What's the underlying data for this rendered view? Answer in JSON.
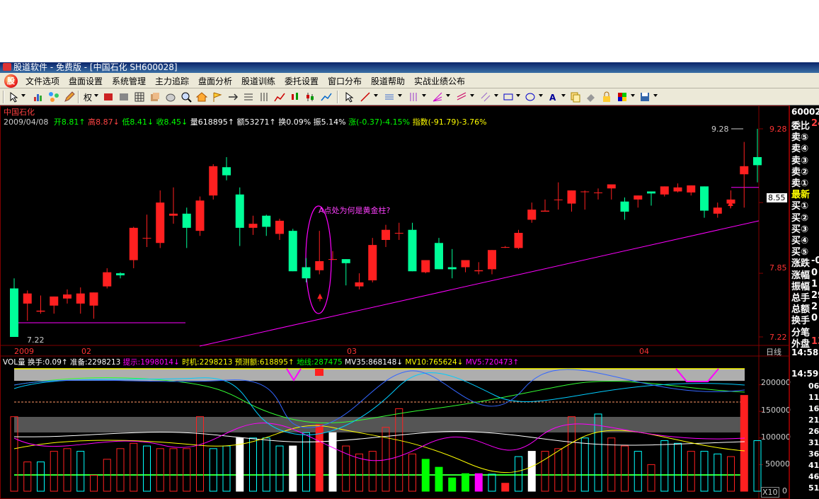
{
  "window": {
    "title": "股道软件 - 免费版 - [中国石化 SH600028]"
  },
  "menu": [
    "文件选项",
    "盘面设置",
    "系统管理",
    "主力追踪",
    "盘面分析",
    "股道训练",
    "委托设置",
    "窗口分布",
    "股道帮助",
    "实战业绩公布"
  ],
  "toolbar": {
    "rights_label": "权"
  },
  "header": {
    "stock_name": "中国石化",
    "date": "2009/04/08",
    "open": "开8.81↑",
    "high": "高8.87↓",
    "low": "低8.41↓",
    "close": "收8.45↓",
    "volume": "量618895↑",
    "amount": "额53271↑",
    "turnover": "换0.09%",
    "amplitude": "振5.14%",
    "change": "涨(-0.37)-4.15%",
    "index": "指数(-91.79)-3.76%"
  },
  "annotation": {
    "question": "A点处为何是黄金柱?",
    "high_label": "9.28",
    "low_label": "7.22"
  },
  "price_axis": {
    "ticks": [
      "9.28",
      "8.55",
      "7.85",
      "7.22"
    ]
  },
  "date_axis": {
    "labels": [
      "2009",
      "02",
      "03",
      "04"
    ],
    "period": "日线"
  },
  "vol_header": {
    "label": "VOL量",
    "turnover": "换手:0.09↑",
    "prepare": "准备:2298213",
    "hint": "提示:1998014↓",
    "timing": "时机:2298213",
    "forecast": "预测额:618895↑",
    "ground": "地线:287475",
    "mv35": "MV35:868148↓",
    "mv10": "MV10:765624↓",
    "mv5": "MV5:720473↑"
  },
  "vol_axis": {
    "ticks": [
      "200000",
      "150000",
      "100000",
      "50000",
      "0"
    ],
    "unit": "X10"
  },
  "side_panel": {
    "code": "60002",
    "rows": [
      "委比",
      "卖⑤",
      "卖④",
      "卖③",
      "卖②",
      "卖①",
      "最新",
      "买①",
      "买②",
      "买③",
      "买④",
      "买⑤",
      "涨跌",
      "涨幅",
      "振幅",
      "总手",
      "总额",
      "换手",
      "分笔",
      "外盘"
    ],
    "values": [
      "24",
      "",
      "",
      "",
      "",
      "",
      "",
      "",
      "",
      "",
      "",
      "",
      "-0",
      "0",
      "1",
      "29",
      "2",
      "0",
      "",
      "13"
    ],
    "times": [
      "14:58",
      "14:59"
    ],
    "tick_vals": [
      "06",
      "11",
      "16",
      "21",
      "26",
      "31",
      "36",
      "41",
      "46",
      "51"
    ]
  },
  "colors": {
    "up": "#ff2020",
    "down": "#00ff99",
    "bg": "#000000",
    "grid": "#800000",
    "magenta": "#ff00ff",
    "yellow": "#ffff00",
    "cyan": "#00ffff"
  },
  "chart_data": {
    "type": "candlestick",
    "candles": [
      {
        "o": 7.7,
        "h": 7.8,
        "l": 7.22,
        "c": 7.22
      },
      {
        "o": 7.55,
        "h": 7.68,
        "l": 7.38,
        "c": 7.65
      },
      {
        "o": 7.47,
        "h": 7.63,
        "l": 7.45,
        "c": 7.48
      },
      {
        "o": 7.53,
        "h": 7.62,
        "l": 7.45,
        "c": 7.62
      },
      {
        "o": 7.6,
        "h": 7.69,
        "l": 7.55,
        "c": 7.64
      },
      {
        "o": 7.55,
        "h": 7.71,
        "l": 7.45,
        "c": 7.65
      },
      {
        "o": 7.53,
        "h": 7.66,
        "l": 7.4,
        "c": 7.66
      },
      {
        "o": 7.72,
        "h": 7.9,
        "l": 7.7,
        "c": 7.86
      },
      {
        "o": 7.85,
        "h": 7.86,
        "l": 7.8,
        "c": 7.83
      },
      {
        "o": 7.98,
        "h": 8.31,
        "l": 7.9,
        "c": 8.3
      },
      {
        "o": 8.2,
        "h": 8.43,
        "l": 8.11,
        "c": 8.2
      },
      {
        "o": 8.15,
        "h": 8.67,
        "l": 8.1,
        "c": 8.55
      },
      {
        "o": 8.42,
        "h": 8.7,
        "l": 8.34,
        "c": 8.44
      },
      {
        "o": 8.44,
        "h": 8.5,
        "l": 8.1,
        "c": 8.3
      },
      {
        "o": 8.27,
        "h": 8.61,
        "l": 8.22,
        "c": 8.57
      },
      {
        "o": 8.62,
        "h": 8.93,
        "l": 8.58,
        "c": 8.91
      },
      {
        "o": 8.9,
        "h": 9.0,
        "l": 8.77,
        "c": 8.82
      },
      {
        "o": 8.63,
        "h": 8.7,
        "l": 8.12,
        "c": 8.3
      },
      {
        "o": 8.3,
        "h": 8.42,
        "l": 8.23,
        "c": 8.34
      },
      {
        "o": 8.42,
        "h": 8.43,
        "l": 8.22,
        "c": 8.31
      },
      {
        "o": 8.24,
        "h": 8.39,
        "l": 8.18,
        "c": 8.37
      },
      {
        "o": 8.27,
        "h": 8.29,
        "l": 7.88,
        "c": 7.87
      },
      {
        "o": 7.91,
        "h": 8.0,
        "l": 7.76,
        "c": 7.8
      },
      {
        "o": 7.88,
        "h": 8.27,
        "l": 7.84,
        "c": 7.97
      },
      {
        "o": 7.99,
        "h": 8.07,
        "l": 7.98,
        "c": 7.99
      },
      {
        "o": 7.99,
        "h": 7.99,
        "l": 7.73,
        "c": 7.95
      },
      {
        "o": 7.72,
        "h": 7.85,
        "l": 7.69,
        "c": 7.76
      },
      {
        "o": 7.78,
        "h": 8.2,
        "l": 7.76,
        "c": 8.13
      },
      {
        "o": 8.18,
        "h": 8.33,
        "l": 8.11,
        "c": 8.28
      },
      {
        "o": 8.25,
        "h": 8.35,
        "l": 8.18,
        "c": 8.25
      },
      {
        "o": 8.28,
        "h": 8.35,
        "l": 7.87,
        "c": 7.87
      },
      {
        "o": 7.86,
        "h": 7.98,
        "l": 7.85,
        "c": 7.98
      },
      {
        "o": 8.15,
        "h": 8.2,
        "l": 7.93,
        "c": 7.89
      },
      {
        "o": 7.91,
        "h": 8.09,
        "l": 7.8,
        "c": 7.89
      },
      {
        "o": 7.91,
        "h": 7.98,
        "l": 7.86,
        "c": 7.98
      },
      {
        "o": 7.87,
        "h": 7.96,
        "l": 7.84,
        "c": 7.88
      },
      {
        "o": 7.89,
        "h": 8.08,
        "l": 7.84,
        "c": 8.08
      },
      {
        "o": 8.11,
        "h": 8.12,
        "l": 8.1,
        "c": 8.11
      },
      {
        "o": 8.1,
        "h": 8.28,
        "l": 8.09,
        "c": 8.25
      },
      {
        "o": 8.38,
        "h": 8.55,
        "l": 8.35,
        "c": 8.48
      },
      {
        "o": 8.46,
        "h": 8.58,
        "l": 8.46,
        "c": 8.47
      },
      {
        "o": 8.58,
        "h": 8.75,
        "l": 8.48,
        "c": 8.58
      },
      {
        "o": 8.54,
        "h": 8.67,
        "l": 8.46,
        "c": 8.67
      },
      {
        "o": 8.66,
        "h": 8.67,
        "l": 8.48,
        "c": 8.66
      },
      {
        "o": 8.65,
        "h": 8.69,
        "l": 8.58,
        "c": 8.65
      },
      {
        "o": 8.69,
        "h": 8.73,
        "l": 8.58,
        "c": 8.73
      },
      {
        "o": 8.56,
        "h": 8.6,
        "l": 8.38,
        "c": 8.46
      },
      {
        "o": 8.58,
        "h": 8.6,
        "l": 8.5,
        "c": 8.62
      },
      {
        "o": 8.66,
        "h": 8.62,
        "l": 8.52,
        "c": 8.64
      },
      {
        "o": 8.63,
        "h": 8.71,
        "l": 8.61,
        "c": 8.71
      },
      {
        "o": 8.66,
        "h": 8.74,
        "l": 8.65,
        "c": 8.7
      },
      {
        "o": 8.65,
        "h": 8.72,
        "l": 8.62,
        "c": 8.72
      },
      {
        "o": 8.71,
        "h": 8.68,
        "l": 8.4,
        "c": 8.47
      },
      {
        "o": 8.44,
        "h": 8.55,
        "l": 8.4,
        "c": 8.5
      },
      {
        "o": 8.54,
        "h": 8.67,
        "l": 8.5,
        "c": 8.58
      },
      {
        "o": 8.83,
        "h": 9.15,
        "l": 8.5,
        "c": 8.91
      },
      {
        "o": 9.0,
        "h": 9.28,
        "l": 8.75,
        "c": 8.92
      }
    ],
    "volume": [
      140000,
      55000,
      55000,
      75000,
      80000,
      75000,
      30000,
      60000,
      80000,
      90000,
      85000,
      80000,
      80000,
      80000,
      140000,
      80000,
      85000,
      100000,
      100000,
      100000,
      85000,
      85000,
      110000,
      125000,
      110000,
      85000,
      70000,
      75000,
      120000,
      155000,
      70000,
      60000,
      45000,
      25000,
      33000,
      33000,
      32000,
      15000,
      65000,
      75000,
      75000,
      80000,
      140000,
      100000,
      145000,
      100000,
      85000,
      75000,
      50000,
      95000,
      90000,
      75000,
      75000,
      70000,
      65000,
      180000,
      95000
    ],
    "volume_marks": {
      "hollow_cyan": [
        2,
        5,
        10,
        15,
        16,
        17,
        18,
        19,
        20,
        21,
        22,
        23,
        24,
        31,
        32,
        33,
        34,
        35,
        36,
        38,
        39,
        43,
        44,
        47,
        49,
        50,
        52,
        53,
        56
      ],
      "white": [
        17,
        21,
        24,
        39
      ],
      "solid_red": [
        23,
        37,
        55
      ],
      "solid_green": [
        31,
        32,
        33,
        34
      ],
      "solid_magenta": [
        35
      ]
    },
    "ylim": [
      7.22,
      9.28
    ],
    "vol_ylim": [
      0,
      230000
    ],
    "xlabels": [
      "2009",
      "02",
      "03",
      "04"
    ]
  }
}
